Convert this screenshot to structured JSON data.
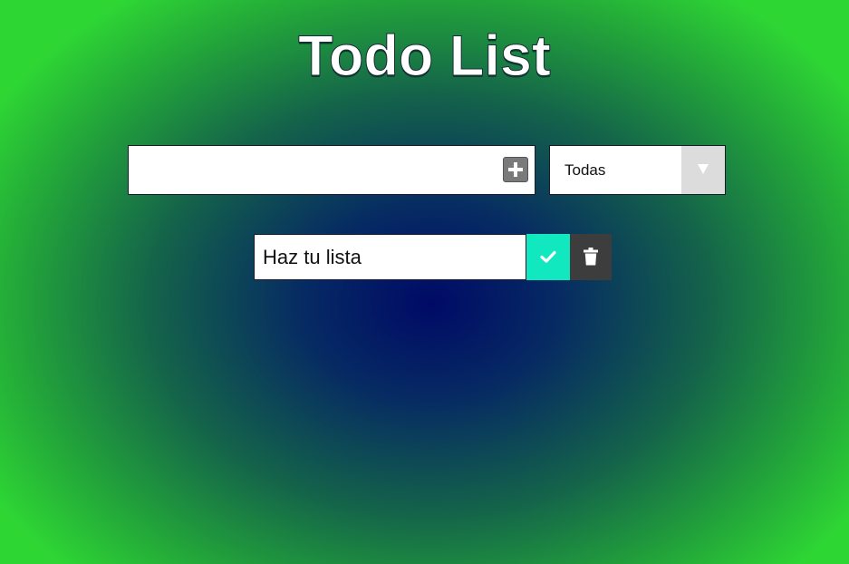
{
  "app": {
    "title": "Todo List"
  },
  "form": {
    "input_value": "",
    "input_placeholder": "",
    "add_icon": "plus-square-icon",
    "filter": {
      "selected": "Todas",
      "arrow_icon": "caret-down-icon"
    }
  },
  "todos": [
    {
      "text": "Haz tu lista",
      "complete_icon": "check-icon",
      "delete_icon": "trash-icon"
    }
  ],
  "colors": {
    "complete_button": "#11e8c0",
    "delete_button": "#3d3d3d",
    "add_button": "#7a7a7a",
    "background_center": "#000a66",
    "background_edge": "#2ed634"
  }
}
